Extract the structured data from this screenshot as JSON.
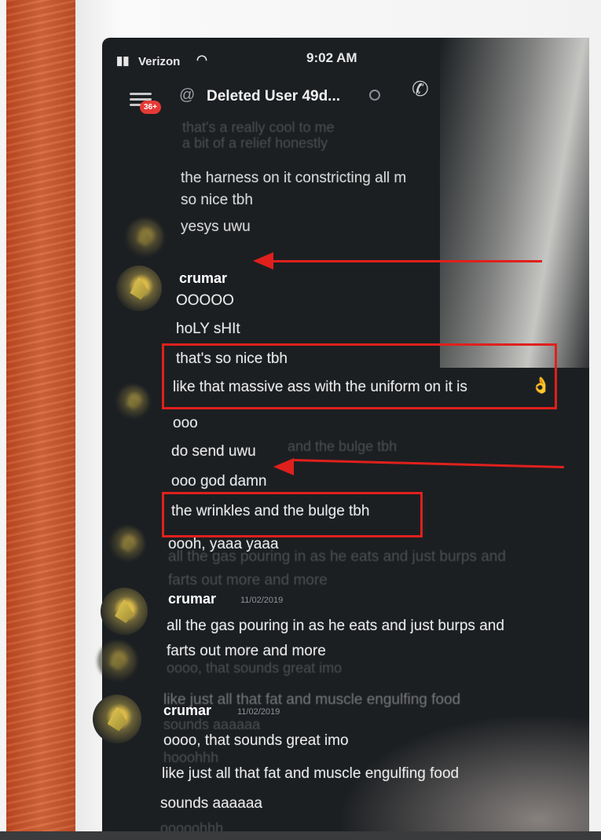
{
  "status_bar": {
    "carrier": "Verizon",
    "time": "9:02 AM"
  },
  "header": {
    "title": "Deleted User 49d...",
    "badge": "36+"
  },
  "messages": {
    "ghost_top_1": "that's a really cool to me",
    "ghost_top_2": "a bit of a relief honestly",
    "harness": "the harness on it constricting all m",
    "so_nice": "so nice tbh",
    "yes_uwu": "yesys uwu",
    "author_1": "crumar",
    "ooooo": "OOOOO",
    "holy": "hoLY sHIt",
    "so_nice_2": "that's so nice tbh",
    "massive": "like that massive ass with the uniform on it is",
    "ooo": "ooo",
    "do_send": "do send uwu",
    "ghost_bulge": "and the bulge tbh",
    "god_damn": "ooo god damn",
    "wrinkles": "the wrinkles and the bulge tbh",
    "yaaa": "oooh, yaaa yaaa",
    "gas_ghost": "all the gas pouring in as he eats and just burps and",
    "farts_ghost": "farts out more and more",
    "author_2": "crumar",
    "author_2_ts": "11/02/2019",
    "gas": "all the gas pouring in as he eats and just burps and",
    "farts": "farts out more and more",
    "sounds_ghost": "oooo, that sounds great imo",
    "fat_ghost": "like just all that fat and muscle engulfing food",
    "author_3": "crumar",
    "author_3_ts": "11/02/2019",
    "sounds_aaa_ghost": "sounds aaaaaa",
    "sounds_great": "oooo, that sounds great imo",
    "hoohh": "hooohhh",
    "fat": "like just all that fat and muscle engulfing food",
    "sounds_aaa": "sounds aaaaaa",
    "last": "ooooohhh"
  },
  "colors": {
    "annotation_red": "#e0201c",
    "screen_bg": "#1c1f22"
  }
}
